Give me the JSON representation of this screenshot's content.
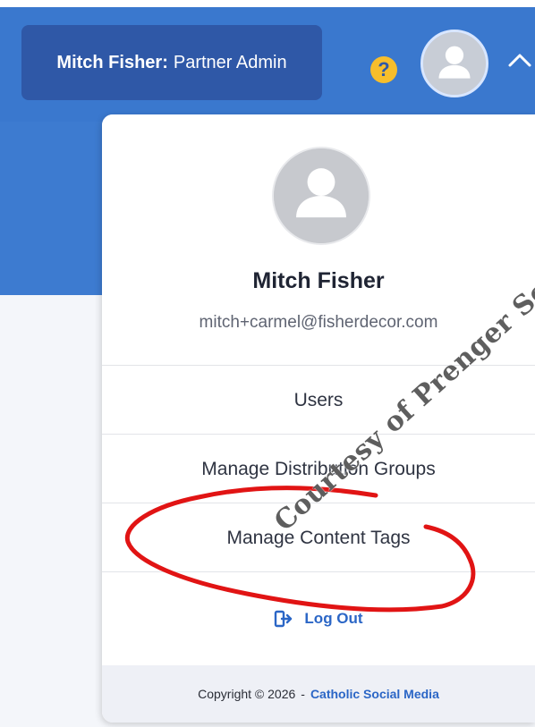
{
  "header": {
    "user_name": "Mitch Fisher:",
    "user_role": "Partner Admin",
    "help_icon": "question-mark-icon",
    "avatar_icon": "user-avatar-icon",
    "chevron_icon": "chevron-up-icon"
  },
  "dropdown": {
    "profile_name": "Mitch Fisher",
    "profile_email": "mitch+carmel@fisherdecor.com",
    "menu_items": [
      "Users",
      "Manage Distribution Groups",
      "Manage Content Tags"
    ],
    "logout": {
      "label": "Log Out",
      "icon": "logout-icon"
    },
    "footer": {
      "copyright": "Copyright © 2026",
      "separator": "-",
      "link_text": "Catholic Social Media"
    }
  },
  "watermark": {
    "text": "Courtesy of Prenger Solutions"
  },
  "colors": {
    "header_blue": "#3a78ce",
    "user_chip_blue": "#2f58a7",
    "help_yellow": "#f7be2c",
    "link_blue": "#2b66c6",
    "annotation_red": "#e11414",
    "footer_bg": "#eef0f6"
  }
}
